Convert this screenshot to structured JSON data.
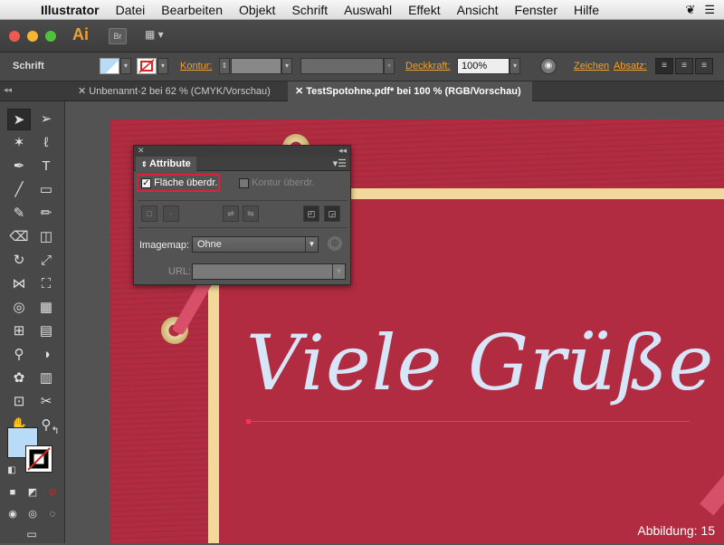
{
  "menubar": {
    "apple": "",
    "app": "Illustrator",
    "items": [
      "Datei",
      "Bearbeiten",
      "Objekt",
      "Schrift",
      "Auswahl",
      "Effekt",
      "Ansicht",
      "Fenster",
      "Hilfe"
    ]
  },
  "appbar": {
    "logo": "Ai",
    "bridge": "Br",
    "workspace_icon": "workspace-switcher-icon"
  },
  "control_bar": {
    "context": "Schrift",
    "stroke_label": "Kontur:",
    "opacity_label": "Deckkraft:",
    "opacity_value": "100%",
    "character_label": "Zeichen",
    "paragraph_label": "Absatz:"
  },
  "tabs": [
    {
      "label": "Unbenannt-2 bei 62 % (CMYK/Vorschau)",
      "active": false
    },
    {
      "label": "TestSpotohne.pdf* bei 100 % (RGB/Vorschau)",
      "active": true
    }
  ],
  "panel": {
    "title": "Attribute",
    "fill_overprint_label": "Fläche überdr.",
    "fill_overprint_checked": true,
    "stroke_overprint_label": "Kontur überdr.",
    "stroke_overprint_checked": false,
    "imagemap_label": "Imagemap:",
    "imagemap_value": "Ohne",
    "url_label": "URL:",
    "url_value": ""
  },
  "artwork": {
    "headline": "Viele Grüße"
  },
  "caption": "Abbildung: 15",
  "colors": {
    "accent_orange": "#f0a030",
    "card_red": "#b12c40",
    "gold": "#f2d89a",
    "script": "#d6e6f8",
    "fill_swatch": "#b8dcf8",
    "highlight_red": "#e0203a"
  }
}
